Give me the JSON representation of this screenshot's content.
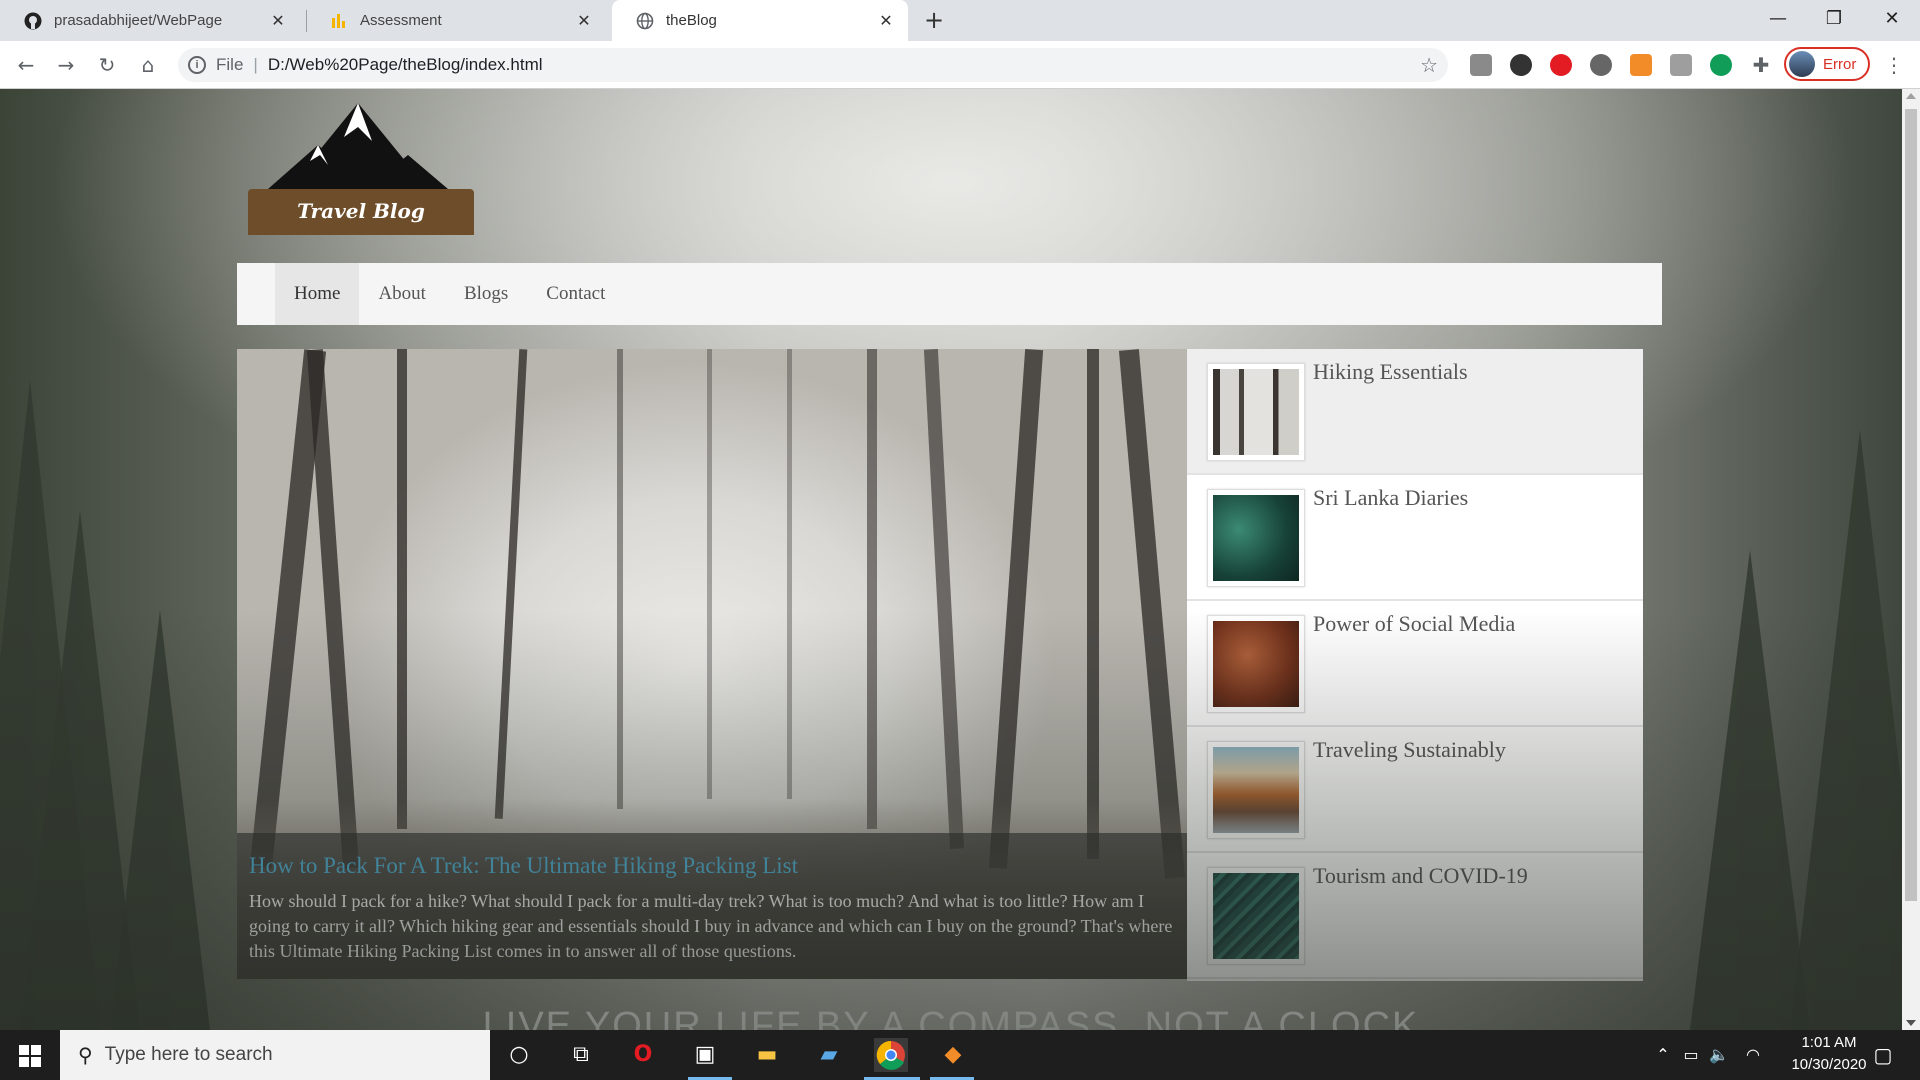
{
  "browser": {
    "tabs": [
      {
        "title": "prasadabhijeet/WebPage",
        "icon": "github-icon",
        "active": false
      },
      {
        "title": "Assessment",
        "icon": "chart-icon",
        "active": false
      },
      {
        "title": "theBlog",
        "icon": "globe-icon",
        "active": true
      }
    ],
    "new_tab_glyph": "+",
    "address": {
      "scheme": "File",
      "url": "D:/Web%20Page/theBlog/index.html"
    },
    "profile_status": "Error"
  },
  "page": {
    "logo_text": "Travel Blog",
    "nav": [
      "Home",
      "About",
      "Blogs",
      "Contact"
    ],
    "active_nav": "Home",
    "featured": {
      "title": "How to Pack For A Trek: The Ultimate Hiking Packing List",
      "excerpt": "How should I pack for a hike? What should I pack for a multi-day trek? What is too much? And what is too little? How am I going to carry it all? Which hiking gear and essentials should I buy in advance and which can I buy on the ground? That's where this Ultimate Hiking Packing List comes in to answer all of those questions."
    },
    "sidebar": [
      {
        "title": "Hiking Essentials",
        "thumb": "misty-forest-image"
      },
      {
        "title": "Sri Lanka Diaries",
        "thumb": "green-leaves-image"
      },
      {
        "title": "Power of Social Media",
        "thumb": "autumn-leaves-image"
      },
      {
        "title": "Traveling Sustainably",
        "thumb": "mountain-lake-image"
      },
      {
        "title": "Tourism and COVID-19",
        "thumb": "fern-image"
      }
    ],
    "tagline": "LIVE YOUR LIFE BY A COMPASS, NOT A CLOCK"
  },
  "taskbar": {
    "search_placeholder": "Type here to search",
    "time": "1:01 AM",
    "date": "10/30/2020"
  },
  "colors": {
    "featured_title": "#4fb3d9",
    "logo_banner": "#6e4e2a",
    "error_chip": "#d93025"
  }
}
